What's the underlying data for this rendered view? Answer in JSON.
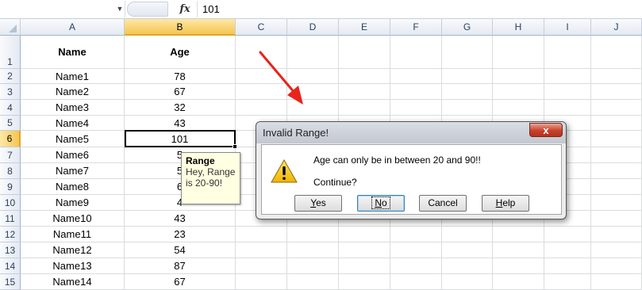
{
  "formula_bar": {
    "name_box": "",
    "fx_label": "fx",
    "formula": "101"
  },
  "columns": [
    "A",
    "B",
    "C",
    "D",
    "E",
    "F",
    "G",
    "H",
    "I",
    "J"
  ],
  "selected_column": "B",
  "rows": [
    {
      "num": "1",
      "a": "Name",
      "b": "Age",
      "header": true
    },
    {
      "num": "2",
      "a": "Name1",
      "b": "78"
    },
    {
      "num": "3",
      "a": "Name2",
      "b": "67"
    },
    {
      "num": "4",
      "a": "Name3",
      "b": "32"
    },
    {
      "num": "5",
      "a": "Name4",
      "b": "43"
    },
    {
      "num": "6",
      "a": "Name5",
      "b": "101",
      "selected": true
    },
    {
      "num": "7",
      "a": "Name6",
      "b": "5"
    },
    {
      "num": "8",
      "a": "Name7",
      "b": "5"
    },
    {
      "num": "9",
      "a": "Name8",
      "b": "6"
    },
    {
      "num": "10",
      "a": "Name9",
      "b": "4"
    },
    {
      "num": "11",
      "a": "Name10",
      "b": "43"
    },
    {
      "num": "12",
      "a": "Name11",
      "b": "23"
    },
    {
      "num": "13",
      "a": "Name12",
      "b": "54"
    },
    {
      "num": "14",
      "a": "Name13",
      "b": "87"
    },
    {
      "num": "15",
      "a": "Name14",
      "b": "67"
    }
  ],
  "input_message": {
    "title": "Range",
    "body": "Hey, Range is 20-90!"
  },
  "dialog": {
    "title": "Invalid Range!",
    "close": "x",
    "message": "Age can only be in between 20 and 90!!",
    "question": "Continue?",
    "buttons": {
      "yes_u": "Y",
      "yes_rest": "es",
      "no_u": "N",
      "no_rest": "o",
      "cancel": "Cancel",
      "help_u": "H",
      "help_rest": "elp"
    }
  },
  "colors": {
    "header_bg": "#e4e9f1",
    "selected_header": "#f5c552",
    "arrow": "#e8241b",
    "tooltip_bg": "#ffffe1",
    "dialog_close": "#c7412b"
  },
  "icons": {
    "warning": "warning-icon",
    "dropdown": "chevron-down-icon",
    "arrow": "red-arrow"
  }
}
